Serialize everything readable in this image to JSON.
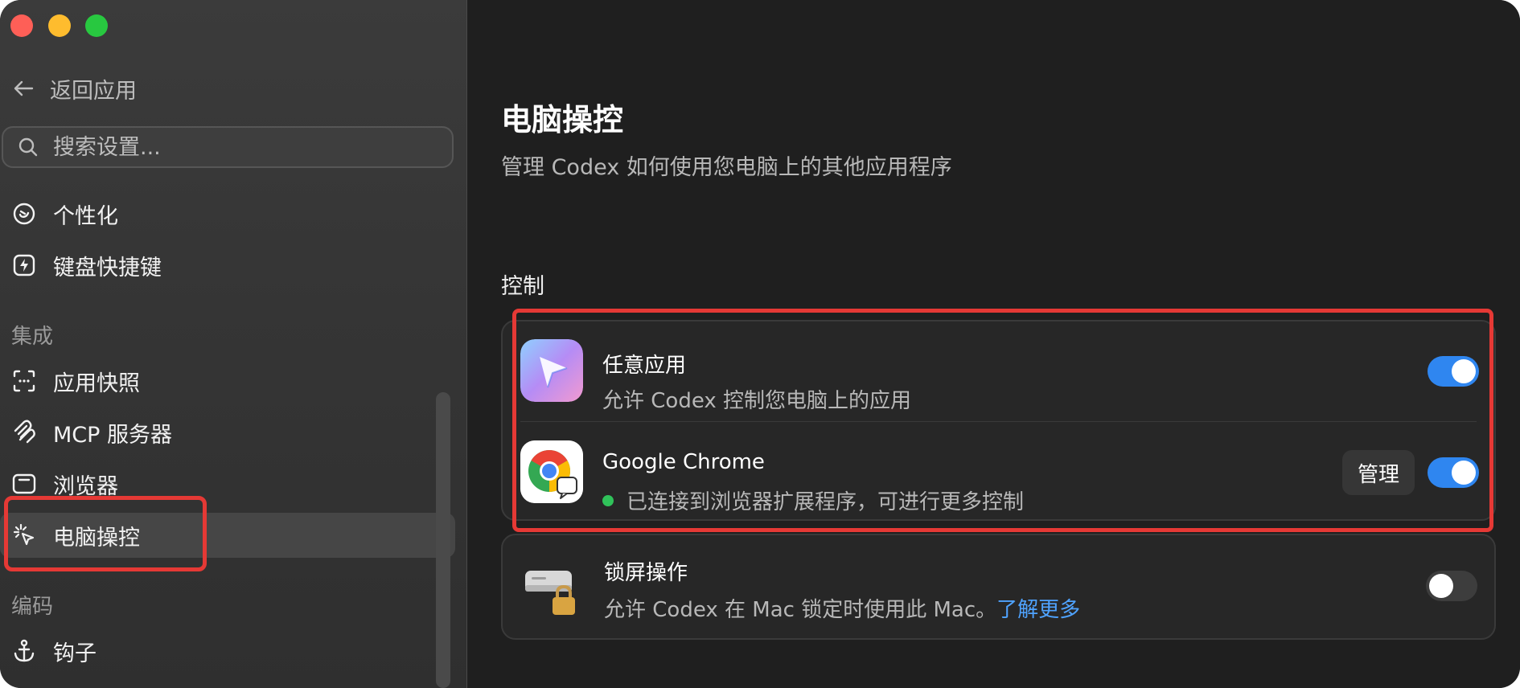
{
  "sidebar": {
    "back_label": "返回应用",
    "search_placeholder": "搜索设置...",
    "items_top": [
      {
        "label": "个性化"
      },
      {
        "label": "键盘快捷键"
      }
    ],
    "section_integration": "集成",
    "items_integration": [
      {
        "label": "应用快照"
      },
      {
        "label": "MCP 服务器"
      },
      {
        "label": "浏览器"
      },
      {
        "label": "电脑操控"
      }
    ],
    "section_coding": "编码",
    "items_coding": [
      {
        "label": "钩子"
      }
    ]
  },
  "main": {
    "title": "电脑操控",
    "subtitle": "管理 Codex 如何使用您电脑上的其他应用程序",
    "group_title": "控制",
    "rows": [
      {
        "title": "任意应用",
        "desc": "允许 Codex 控制您电脑上的应用",
        "toggle": "on"
      },
      {
        "title": "Google Chrome",
        "desc": "已连接到浏览器扩展程序，可进行更多控制",
        "manage_label": "管理",
        "toggle": "on",
        "status_color": "#30c25a"
      }
    ],
    "lock_row": {
      "title": "锁屏操作",
      "desc": "允许 Codex 在 Mac 锁定时使用此 Mac。",
      "link": "了解更多",
      "toggle": "off"
    }
  },
  "colors": {
    "accent": "#2f86f0",
    "highlight": "#e53935",
    "link": "#4fa3ff"
  }
}
